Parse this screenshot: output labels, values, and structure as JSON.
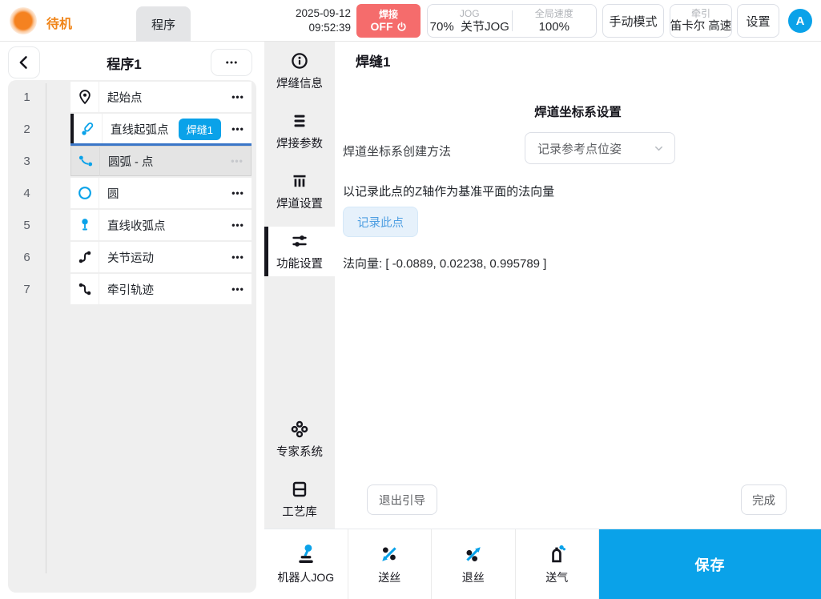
{
  "topbar": {
    "status": "待机",
    "tab": "程序",
    "date": "2025-09-12",
    "time": "09:52:39",
    "weld": {
      "line1": "焊接",
      "line2": "OFF"
    },
    "jog": {
      "label": "JOG",
      "value": "70%",
      "mode": "关节JOG"
    },
    "speed": {
      "label": "全局速度",
      "value": "100%"
    },
    "manual_mode": "手动模式",
    "traction": {
      "label": "牵引",
      "value": "笛卡尔 高速"
    },
    "settings": "设置",
    "avatar": "A"
  },
  "program_panel": {
    "title": "程序1",
    "rows": [
      {
        "num": "1",
        "label": "起始点"
      },
      {
        "num": "2",
        "label": "直线起弧点",
        "badge": "焊缝1"
      },
      {
        "num": "3",
        "label": "圆弧 - 点"
      },
      {
        "num": "4",
        "label": "圆"
      },
      {
        "num": "5",
        "label": "直线收弧点"
      },
      {
        "num": "6",
        "label": "关节运动"
      },
      {
        "num": "7",
        "label": "牵引轨迹"
      }
    ]
  },
  "nav": {
    "items": [
      {
        "label": "焊缝信息"
      },
      {
        "label": "焊接参数"
      },
      {
        "label": "焊道设置"
      },
      {
        "label": "功能设置"
      },
      {
        "label": "专家系统"
      },
      {
        "label": "工艺库"
      }
    ]
  },
  "main": {
    "title": "焊缝1",
    "section_title": "焊道坐标系设置",
    "method_label": "焊道坐标系创建方法",
    "method_value": "记录参考点位姿",
    "hint": "以记录此点的Z轴作为基准平面的法向量",
    "record_button": "记录此点",
    "normal_vector": "法向量: [ -0.0889, 0.02238, 0.995789 ]",
    "exit_button": "退出引导",
    "done_button": "完成"
  },
  "bottombar": {
    "items": [
      {
        "label": "机器人JOG"
      },
      {
        "label": "送丝"
      },
      {
        "label": "退丝"
      },
      {
        "label": "送气"
      }
    ],
    "save_button": "保存"
  },
  "ui": {
    "more": "●●●"
  },
  "colors": {
    "accent": "#0aa2e9",
    "danger": "#f56c6c",
    "status_orange": "#f08519",
    "indicator_blue": "#3a76c8"
  }
}
